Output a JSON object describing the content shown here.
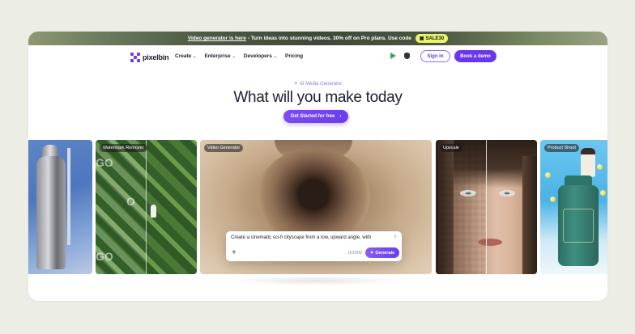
{
  "banner": {
    "text_lead": "Video generator is here",
    "text_rest": " - Turn ideas into stunning videos. 30% off on Pro plans. Use code",
    "coupon": "SALE30"
  },
  "nav": {
    "logo": "pixelbin",
    "menu": [
      {
        "label": "Create",
        "has_caret": true
      },
      {
        "label": "Enterprise",
        "has_caret": true
      },
      {
        "label": "Developers",
        "has_caret": true
      },
      {
        "label": "Pricing",
        "has_caret": false
      }
    ],
    "store_icons": [
      "google-play-icon",
      "apple-icon"
    ],
    "signin": "Sign in",
    "demo": "Book a demo"
  },
  "hero": {
    "kicker": "AI Media Generator",
    "headline": "What will you make today",
    "cta": "Get Started for free"
  },
  "cards": [
    {
      "label": ""
    },
    {
      "label": "Watermark Remover"
    },
    {
      "label": "Video Generator"
    },
    {
      "label": "Upscale"
    },
    {
      "label": "Product Shoot"
    }
  ],
  "prompt": {
    "text": "Create a cinematic sci-fi cityscape from a low, upward angle, with",
    "counter": "0/1000",
    "generate": "Generate"
  },
  "watermark_glyphs": [
    "GO",
    "O",
    "GO"
  ],
  "colors": {
    "accent": "#6a3df0",
    "coupon": "#e7f56a"
  }
}
